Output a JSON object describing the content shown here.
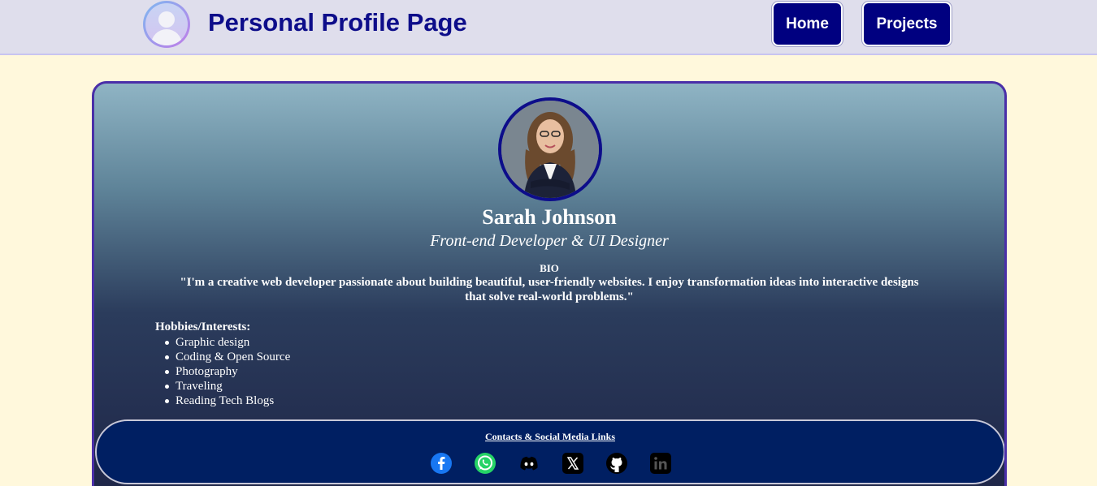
{
  "header": {
    "title": "Personal Profile Page",
    "nav": {
      "home": "Home",
      "projects": "Projects"
    }
  },
  "profile": {
    "name": "Sarah Johnson",
    "role": "Front-end Developer & UI Designer",
    "bio_heading": "BIO",
    "bio": "\"I'm a creative web developer passionate about building beautiful, user-friendly websites. I enjoy transformation ideas into interactive designs that solve real-world problems.\"",
    "hobbies_heading": "Hobbies/Interests:",
    "hobbies": [
      "Graphic design",
      "Coding & Open Source",
      "Photography",
      "Traveling",
      "Reading Tech Blogs"
    ]
  },
  "footer": {
    "link_text": "Contacts & Social Media Links",
    "socials": [
      "facebook-icon",
      "whatsapp-icon",
      "discord-icon",
      "x-icon",
      "github-icon",
      "linkedin-icon"
    ]
  },
  "colors": {
    "nav_button": "#000080",
    "title": "#0d0d8a",
    "footer_bg": "#001f62",
    "page_bg": "#fff8dc"
  }
}
